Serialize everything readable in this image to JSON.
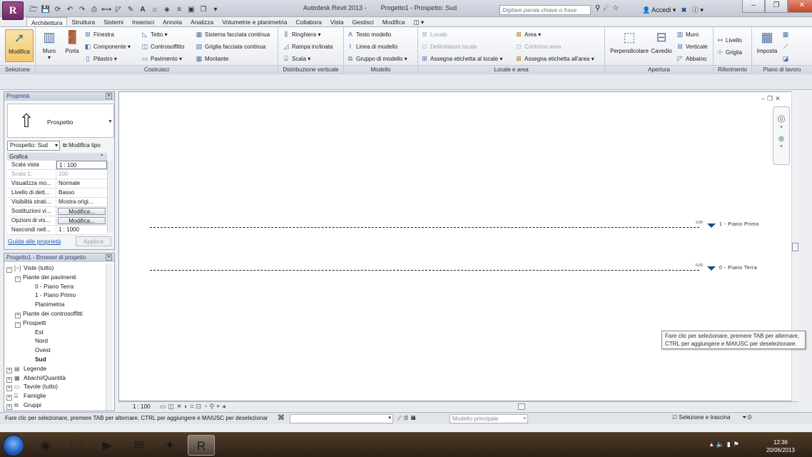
{
  "titlebar": {
    "app_logo": "R",
    "app_title": "Autodesk Revit 2013 -",
    "doc_title": "Progetto1 - Prospetto: Sud",
    "search_placeholder": "Digitare parola chiave o frase",
    "sign_in": "Accedi"
  },
  "tabs": [
    "Architettura",
    "Struttura",
    "Sistemi",
    "Inserisci",
    "Annota",
    "Analizza",
    "Volumetrie e planimetria",
    "Collabora",
    "Vista",
    "Gestisci",
    "Modifica"
  ],
  "ribbon": {
    "selection": {
      "label": "Selezione",
      "modify": "Modifica"
    },
    "build": {
      "label": "Costruisci",
      "wall": "Muro",
      "door": "Porta",
      "window": "Finestra",
      "component": "Componente",
      "column": "Pilastro",
      "roof": "Tetto",
      "ceiling": "Controsoffitto",
      "floor": "Pavimento",
      "curtain_system": "Sistema facciata continua",
      "curtain_grid": "Griglia facciata continua",
      "mullion": "Montante"
    },
    "circulation": {
      "label": "Distribuzione verticale",
      "railing": "Ringhiera",
      "ramp": "Rampa inclinata",
      "stair": "Scala"
    },
    "model": {
      "label": "Modello",
      "text": "Testo modello",
      "line": "Linea di modello",
      "group": "Gruppo di modello"
    },
    "room_area": {
      "label": "Locale e area",
      "room": "Locale",
      "room_separator": "Delimitatore locale",
      "tag_room": "Assegna etichetta  al locale",
      "area": "Area",
      "area_boundary": "Contorno area",
      "tag_area": "Assegna etichetta  all'area"
    },
    "opening": {
      "label": "Apertura",
      "by_face": "Perpendicolare",
      "shaft": "Cavedio",
      "wall": "Muro",
      "vertical": "Verticale",
      "dormer": "Abbaino"
    },
    "datum": {
      "label": "Riferimento",
      "level": "Livello",
      "grid": "Griglia"
    },
    "work_plane": {
      "label": "Piano di lavoro",
      "set": "Imposta"
    }
  },
  "properties": {
    "title": "Proprietà",
    "type_name": "Prospetto",
    "view_selector": "Prospetto: Sud",
    "edit_type": "Modifica tipo",
    "group": "Grafica",
    "rows": [
      {
        "k": "Scala vista",
        "v": "1 : 100"
      },
      {
        "k": "Scala  1:",
        "v": "100"
      },
      {
        "k": "Visualizza mo...",
        "v": "Normale"
      },
      {
        "k": "Livello di dett...",
        "v": "Basso"
      },
      {
        "k": "Visibilità strati...",
        "v": "Mostra origi..."
      },
      {
        "k": "Sostituzioni vi...",
        "v": "Modifica..."
      },
      {
        "k": "Opzioni di vis...",
        "v": "Modifica..."
      },
      {
        "k": "Nascondi nell...",
        "v": "1 : 1000"
      }
    ],
    "guide_link": "Guida alle proprietà",
    "apply": "Applica"
  },
  "browser": {
    "title": "Progetto1 - Browser di progetto",
    "items": [
      {
        "label": "Viste (tutto)"
      },
      {
        "label": "Piante dei pavimenti"
      },
      {
        "label": "0 - Piano Terra"
      },
      {
        "label": "1 - Piano Primo"
      },
      {
        "label": "Planimetria"
      },
      {
        "label": "Piante dei controsoffitti"
      },
      {
        "label": "Prospetti"
      },
      {
        "label": "Est"
      },
      {
        "label": "Nord"
      },
      {
        "label": "Ovest"
      },
      {
        "label": "Sud"
      },
      {
        "label": "Legende"
      },
      {
        "label": "Abachi/Quantità"
      },
      {
        "label": "Tavole (tutto)"
      },
      {
        "label": "Famiglie"
      },
      {
        "label": "Gruppi"
      }
    ],
    "expanders": {
      "minus": "−",
      "plus": "+"
    }
  },
  "canvas": {
    "levels": [
      {
        "name": "1 - Piano Primo",
        "value": "3.00"
      },
      {
        "name": "0 - Piano Terra",
        "value": "0.00"
      }
    ],
    "tooltip": "Fare clic per selezionare, premere TAB per alternare, CTRL per aggiungere e MAIUSC per deselezionare."
  },
  "viewbar": {
    "scale": "1 : 100"
  },
  "statusbar": {
    "hint": "Fare clic per selezionare, premere TAB per alternare, CTRL per aggiungere e MAIUSC per deselezionar",
    "worksets": ":0",
    "design_option": "Modello principale",
    "drag": "Selezione e trascina",
    "filter": ":0"
  },
  "clock": {
    "time": "12:36",
    "date": "20/06/2013"
  },
  "colors": {
    "accent": "#1a4c8c",
    "selected": "#f2c86c",
    "link": "#1f5bb8"
  }
}
